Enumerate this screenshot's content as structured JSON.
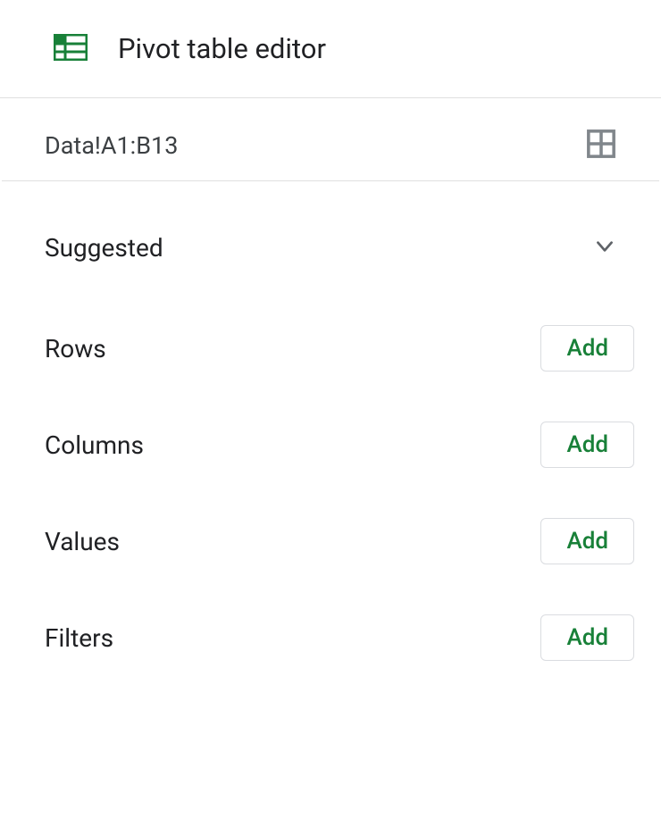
{
  "header": {
    "title": "Pivot table editor"
  },
  "dataRange": "Data!A1:B13",
  "suggested": {
    "label": "Suggested"
  },
  "sections": [
    {
      "label": "Rows",
      "buttonLabel": "Add"
    },
    {
      "label": "Columns",
      "buttonLabel": "Add"
    },
    {
      "label": "Values",
      "buttonLabel": "Add"
    },
    {
      "label": "Filters",
      "buttonLabel": "Add"
    }
  ],
  "colors": {
    "brandGreen": "#188038",
    "iconGray": "#80868b"
  }
}
